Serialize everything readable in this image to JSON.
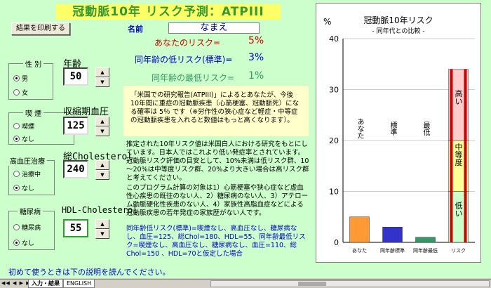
{
  "title": "冠動脈10年 リスク予測：ATPIII",
  "print_button": "結果を印刷する",
  "name_label": "名前",
  "name_value": "なまえ",
  "your_risk_label": "あなたのリスク=",
  "your_risk_value": "5%",
  "low_risk_label": "同年齢の低リスク(標準)=",
  "low_risk_value": "3%",
  "min_risk_label": "同年齢の最低リスク=",
  "min_risk_value": "1%",
  "sex": {
    "title": "性 別",
    "options": [
      "男",
      "女"
    ],
    "selected": 0
  },
  "smoking": {
    "title": "喫 煙",
    "options": [
      "喫煙",
      "なし"
    ],
    "selected": 1
  },
  "htn": {
    "title": "高血圧治療",
    "options": [
      "治療中",
      "なし"
    ],
    "selected": 1
  },
  "dm": {
    "title": "糖尿病",
    "options": [
      "糖尿病",
      "なし"
    ],
    "selected": 1
  },
  "age": {
    "label": "年齢",
    "value": "50"
  },
  "sbp": {
    "label": "収縮期血圧",
    "value": "125"
  },
  "chol": {
    "label": "総Cholesterol",
    "value": "240"
  },
  "hdl": {
    "label": "HDL-Cholesterol",
    "value": "55"
  },
  "info_text": "「米国での研究報告(ATPIII)」によるとあなたが、今後10年間に重症の冠動脈疾患（心筋梗塞、冠動脈死）になる確率は 5％ です（※労作性の狭心症など軽症・中等症の冠動脈疾患を入れると数値はもっと高くなります）。",
  "para1": "推定された10年リスク値は米国白人における研究をもとにしています。日本人ではこれより低い発症率とされています。冠動脈リスク評価の目安として、10%未満は低リスク群、10～20%は中等度リスク群、20%より大きい場合は高リスク群と考えてください。",
  "para2": "このプログラム計算の対象は1）心筋梗塞や狭心症など虚血性心疾患の既往のない人、2）糖尿病のない人、3）アテローム動脈硬化性疾患のない人、4）家族性高脂血症などによる冠動脈疾患の若年発症の家族歴がない人です。",
  "para3": "同年齢低リスク(標準)=喫煙なし、高血圧なし、糖尿病なし、血圧=125、総Chol=180、HDL=55、同年齢最低リスク=喫煙なし、高血圧なし、糖尿病なし、血圧=110、総Chol=150 、HDL=70と仮定した場合",
  "hint": "初めて使うときは下の説明を読んでください。",
  "tabs": [
    "入力・結果",
    "ENGLISH"
  ],
  "chart_data": {
    "type": "bar",
    "title": "冠動脈10年リスク",
    "subtitle": "- 同年代との比較 -",
    "ylabel": "%",
    "ylim": [
      0,
      40
    ],
    "yticks": [
      0,
      10,
      20,
      30,
      40
    ],
    "categories": [
      "あなた",
      "同年齢標準",
      "同年齢最低",
      "リスク"
    ],
    "values": [
      5,
      3,
      1,
      34
    ],
    "colors": [
      "#ff9933",
      "#3333cc",
      "#339966"
    ],
    "bar_labels": [
      "あなた",
      "標準",
      "最低"
    ],
    "risk_segments": [
      {
        "label": "低い",
        "from": 0,
        "to": 10,
        "color": "#ccffcc"
      },
      {
        "label": "中等度",
        "from": 10,
        "to": 20,
        "color": "#ffff99"
      },
      {
        "label": "高い",
        "from": 20,
        "to": 34,
        "color": "#ffcccc"
      }
    ],
    "grid": true
  }
}
